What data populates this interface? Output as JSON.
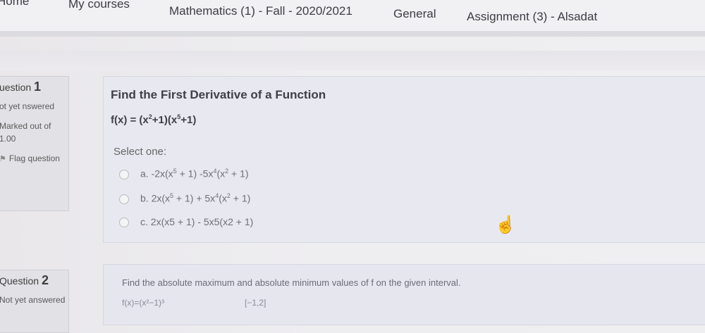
{
  "breadcrumb": {
    "home": "Home",
    "courses": "My courses",
    "course": "Mathematics (1) - Fall - 2020/2021",
    "section": "General",
    "assignment": "Assignment (3) - Alsadat"
  },
  "question1": {
    "number_label": "uestion",
    "number": "1",
    "state": "ot yet nswered",
    "grade": "Marked out of 1.00",
    "flag": "Flag question",
    "title": "Find the First Derivative of a Function",
    "function_prefix": "f(x) = (x",
    "function_mid": "+1)(x",
    "function_suffix": "+1)",
    "select_label": "Select one:",
    "options": [
      {
        "label": "a. -2x(x",
        "rest": " + 1) -5x",
        "rest2": "(x",
        "rest3": " + 1)"
      },
      {
        "label": "b. 2x(x",
        "rest": " + 1) + 5x",
        "rest2": "(x",
        "rest3": " + 1)"
      },
      {
        "label": "c. 2x(x5 + 1) - 5x5(x2 + 1)"
      }
    ]
  },
  "question2": {
    "number_label": "Question",
    "number": "2",
    "state": "Not yet answered",
    "text": "Find the absolute maximum and absolute minimum values of f on the given interval.",
    "function": "f(x)=(x²−1)³",
    "interval": "[−1,2]"
  },
  "icons": {
    "flag": "flag-icon",
    "pointer": "hand-pointer-icon"
  }
}
